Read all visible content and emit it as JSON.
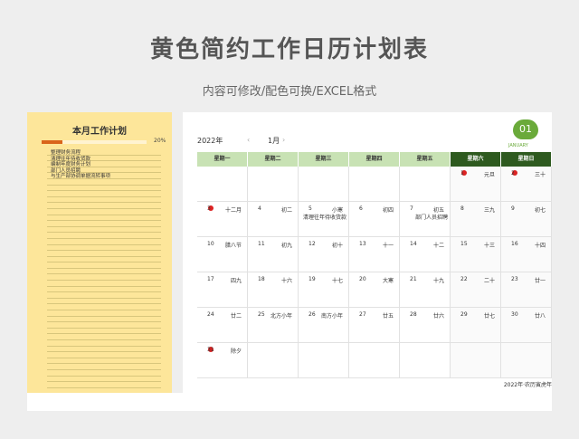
{
  "page": {
    "title": "黄色简约工作日历计划表",
    "subtitle": "内容可修改/配色可换/EXCEL格式"
  },
  "sidebar": {
    "title": "本月工作计划",
    "progress_label": "20%",
    "progress_value": 0.2,
    "tasks": [
      "整理财务流程",
      "清理往年待收货款",
      "编制年度财务计划",
      "部门人员招聘",
      "与生产部协调单据流转事项",
      "",
      "",
      "",
      "",
      "",
      "",
      "",
      "",
      "",
      "",
      "",
      "",
      "",
      "",
      "",
      "",
      "",
      "",
      "",
      "",
      "",
      "",
      "",
      "",
      "",
      "",
      "",
      "",
      "",
      "",
      "",
      "",
      "",
      "",
      ""
    ]
  },
  "calendar": {
    "year": "2022年",
    "month": "1月",
    "nav_prev": "‹",
    "nav_next": "›",
    "month_badge": "01",
    "month_badge_sub": "JANUARY",
    "weekdays": [
      "星期一",
      "星期二",
      "星期三",
      "星期四",
      "星期五",
      "星期六",
      "星期日"
    ],
    "weeks": [
      [
        {
          "day": "",
          "lunar": "",
          "event": ""
        },
        {
          "day": "",
          "lunar": "",
          "event": ""
        },
        {
          "day": "",
          "lunar": "",
          "event": ""
        },
        {
          "day": "",
          "lunar": "",
          "event": ""
        },
        {
          "day": "",
          "lunar": "",
          "event": ""
        },
        {
          "day": "1",
          "lunar": "元旦",
          "event": "",
          "dot": true
        },
        {
          "day": "2",
          "lunar": "三十",
          "event": "",
          "dot": true
        }
      ],
      [
        {
          "day": "3",
          "lunar": "十二月",
          "event": "",
          "dot": true
        },
        {
          "day": "4",
          "lunar": "初二",
          "event": ""
        },
        {
          "day": "5",
          "lunar": "小寒",
          "event": "清理往年待收货款"
        },
        {
          "day": "6",
          "lunar": "初四",
          "event": ""
        },
        {
          "day": "7",
          "lunar": "初五",
          "event": "部门人员招聘"
        },
        {
          "day": "8",
          "lunar": "三九",
          "event": ""
        },
        {
          "day": "9",
          "lunar": "初七",
          "event": ""
        }
      ],
      [
        {
          "day": "10",
          "lunar": "腊八节",
          "event": ""
        },
        {
          "day": "11",
          "lunar": "初九",
          "event": ""
        },
        {
          "day": "12",
          "lunar": "初十",
          "event": ""
        },
        {
          "day": "13",
          "lunar": "十一",
          "event": ""
        },
        {
          "day": "14",
          "lunar": "十二",
          "event": ""
        },
        {
          "day": "15",
          "lunar": "十三",
          "event": ""
        },
        {
          "day": "16",
          "lunar": "十四",
          "event": ""
        }
      ],
      [
        {
          "day": "17",
          "lunar": "四九",
          "event": ""
        },
        {
          "day": "18",
          "lunar": "十六",
          "event": ""
        },
        {
          "day": "19",
          "lunar": "十七",
          "event": ""
        },
        {
          "day": "20",
          "lunar": "大寒",
          "event": ""
        },
        {
          "day": "21",
          "lunar": "十九",
          "event": ""
        },
        {
          "day": "22",
          "lunar": "二十",
          "event": ""
        },
        {
          "day": "23",
          "lunar": "廿一",
          "event": ""
        }
      ],
      [
        {
          "day": "24",
          "lunar": "廿二",
          "event": ""
        },
        {
          "day": "25",
          "lunar": "北方小年",
          "event": ""
        },
        {
          "day": "26",
          "lunar": "南方小年",
          "event": ""
        },
        {
          "day": "27",
          "lunar": "廿五",
          "event": ""
        },
        {
          "day": "28",
          "lunar": "廿六",
          "event": ""
        },
        {
          "day": "29",
          "lunar": "廿七",
          "event": ""
        },
        {
          "day": "30",
          "lunar": "廿八",
          "event": ""
        }
      ],
      [
        {
          "day": "31",
          "lunar": "除夕",
          "event": "",
          "dot": true
        },
        {
          "day": "",
          "lunar": "",
          "event": ""
        },
        {
          "day": "",
          "lunar": "",
          "event": ""
        },
        {
          "day": "",
          "lunar": "",
          "event": ""
        },
        {
          "day": "",
          "lunar": "",
          "event": ""
        },
        {
          "day": "",
          "lunar": "",
          "event": ""
        },
        {
          "day": "",
          "lunar": "",
          "event": ""
        }
      ]
    ],
    "footer": "2022年·农历寅虎年"
  },
  "colors": {
    "sidebar_bg": "#fde69a",
    "progress": "#d9651b",
    "header_green": "#c8e2b4",
    "weekend_header": "#2e5a1f",
    "badge": "#6aaa3a"
  }
}
